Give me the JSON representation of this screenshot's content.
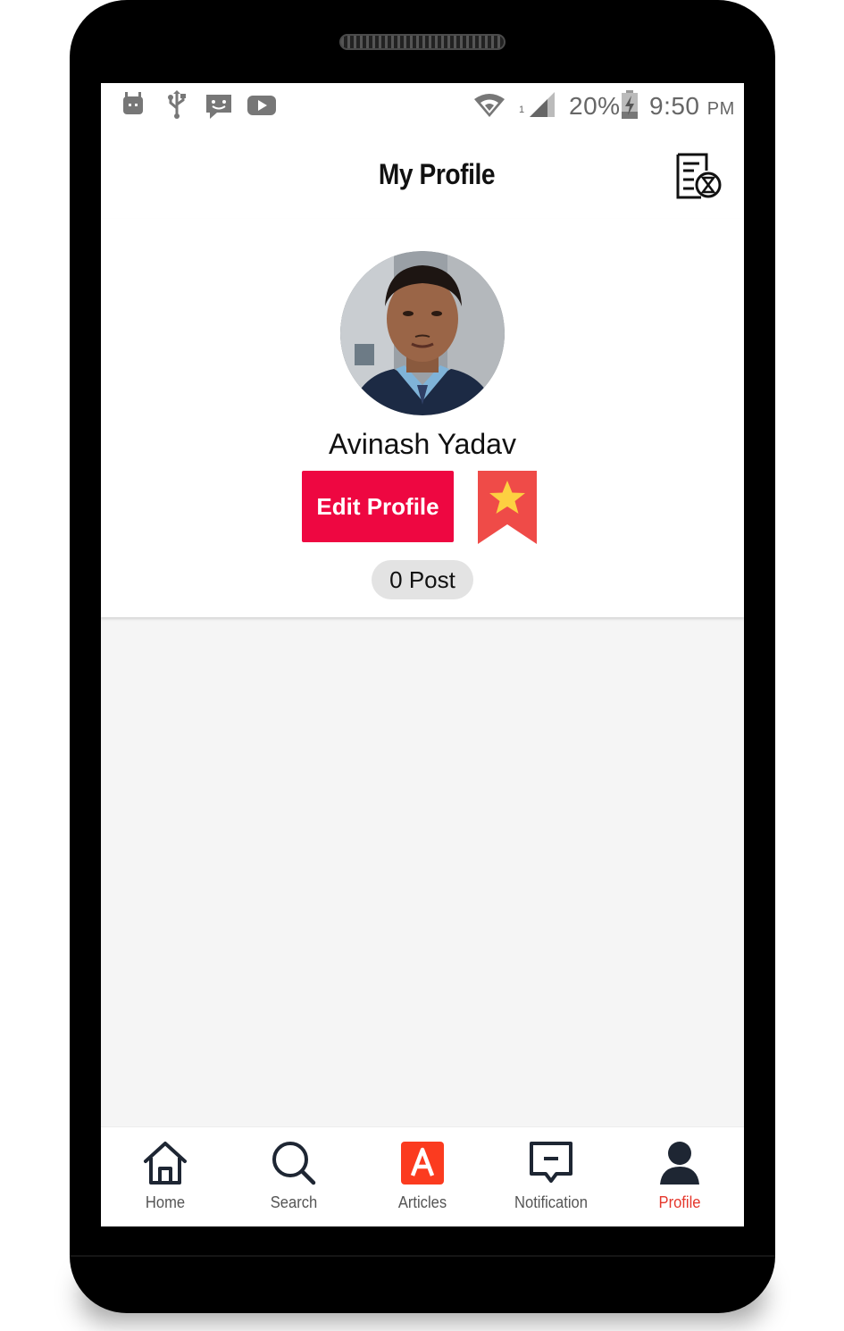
{
  "status_bar": {
    "battery": "20%",
    "time": "9:50",
    "ampm": "PM",
    "sim_slot": "1",
    "icons": [
      "android-debug-icon",
      "usb-icon",
      "message-icon",
      "youtube-icon",
      "wifi-icon",
      "signal-icon",
      "battery-charging-icon"
    ]
  },
  "header": {
    "title": "My Profile",
    "action_icon": "history-icon"
  },
  "profile": {
    "name": "Avinash Yadav",
    "edit_label": "Edit Profile",
    "post_count": "0 Post",
    "bookmark_icon": "bookmark-star-icon"
  },
  "bottom_nav": {
    "items": [
      {
        "label": "Home",
        "icon": "home-icon",
        "active": false
      },
      {
        "label": "Search",
        "icon": "search-icon",
        "active": false
      },
      {
        "label": "Articles",
        "icon": "articles-icon",
        "active": false
      },
      {
        "label": "Notification",
        "icon": "notification-icon",
        "active": false
      },
      {
        "label": "Profile",
        "icon": "profile-icon",
        "active": true
      }
    ]
  },
  "colors": {
    "accent": "#ee0741",
    "active_nav": "#e5372c",
    "bookmark": "#ef4b48",
    "star": "#fdd041",
    "articles": "#fb3b1f"
  }
}
